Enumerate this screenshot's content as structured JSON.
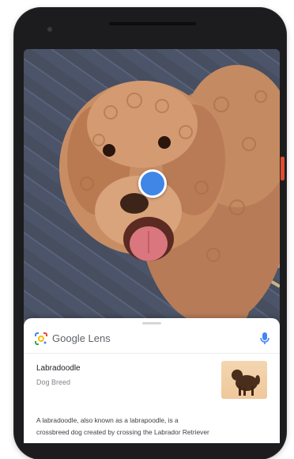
{
  "lens": {
    "brand": "Google",
    "product": "Lens"
  },
  "result": {
    "title": "Labradoodle",
    "subtitle": "Dog Breed"
  },
  "description": {
    "line1": "A labradoodle, also known as a labrapoodle, is a",
    "line2": "crossbreed dog created by crossing the Labrador Retriever"
  },
  "colors": {
    "lens_dot": "#3f86e6",
    "accent_side_button": "#e04a2f"
  }
}
